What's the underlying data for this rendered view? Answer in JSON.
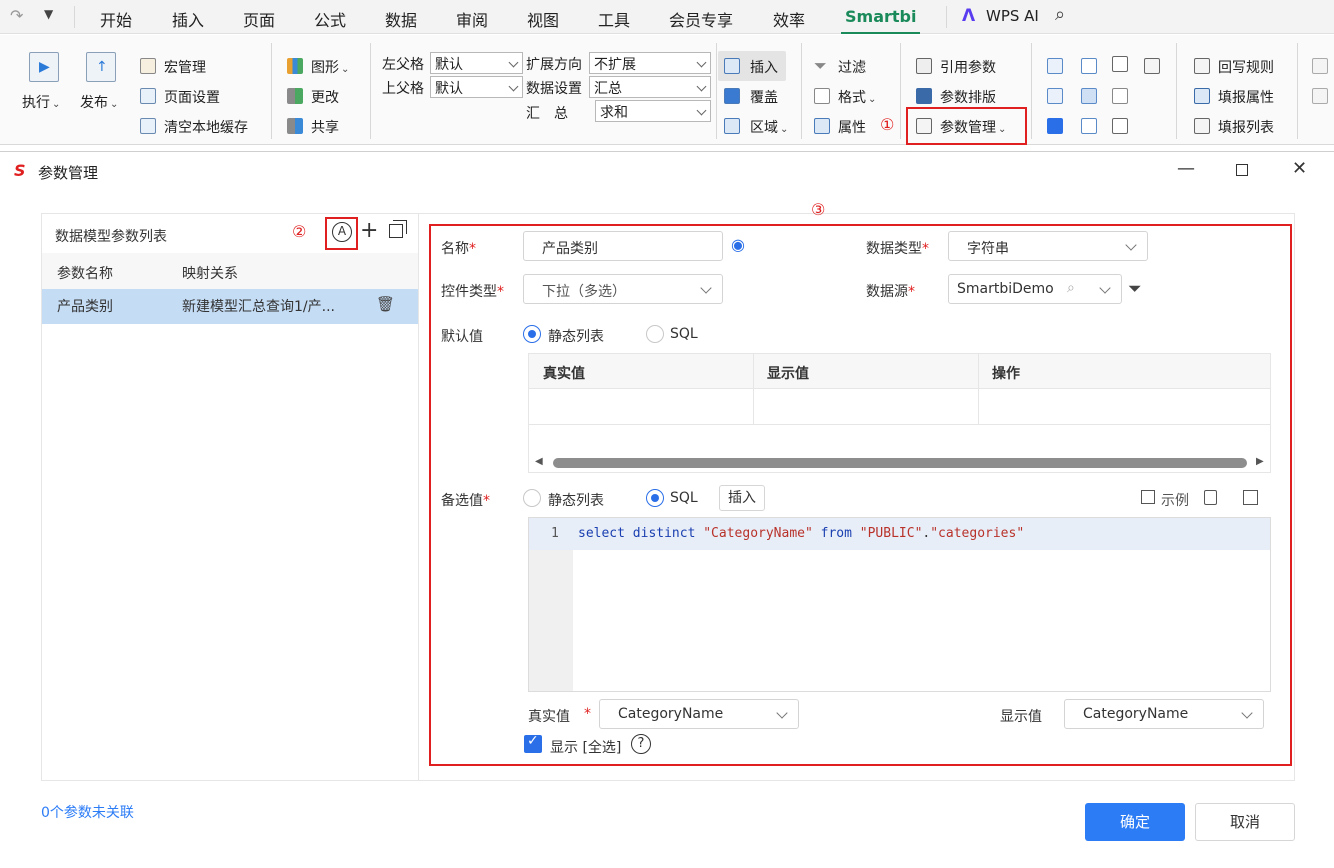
{
  "menubar": {
    "tabs": [
      "开始",
      "插入",
      "页面",
      "公式",
      "数据",
      "审阅",
      "视图",
      "工具",
      "会员专享",
      "效率",
      "Smartbi"
    ],
    "active_tab": "Smartbi",
    "wps_ai": "WPS AI"
  },
  "ribbon": {
    "exec": "执行",
    "publish": "发布",
    "macro": "宏管理",
    "page_setup": "页面设置",
    "clear_cache": "清空本地缓存",
    "graph": "图形",
    "change": "更改",
    "share": "共享",
    "left_parent_label": "左父格",
    "left_parent_value": "默认",
    "top_parent_label": "上父格",
    "top_parent_value": "默认",
    "expand_dir_label": "扩展方向",
    "expand_dir_value": "不扩展",
    "data_setting_label": "数据设置",
    "data_setting_value": "汇总",
    "summary_label": "汇　总",
    "summary_value": "求和",
    "insert": "插入",
    "cover": "覆盖",
    "region": "区域",
    "filter": "过滤",
    "format": "格式",
    "property": "属性",
    "ref_param": "引用参数",
    "param_layout": "参数排版",
    "param_manage": "参数管理",
    "writeback_rule": "回写规则",
    "fill_property": "填报属性",
    "fill_list": "填报列表"
  },
  "markers": {
    "one": "①",
    "two": "②",
    "three": "③"
  },
  "dialog": {
    "title": "参数管理",
    "left_panel_title": "数据模型参数列表",
    "col_param_name": "参数名称",
    "col_mapping": "映射关系",
    "rows": [
      {
        "name": "产品类别",
        "mapping": "新建模型汇总查询1/产..."
      }
    ],
    "unlinked": "0个参数未关联",
    "ok": "确定",
    "cancel": "取消"
  },
  "form": {
    "name_label": "名称",
    "name_value": "产品类别",
    "datatype_label": "数据类型",
    "datatype_value": "字符串",
    "control_label": "控件类型",
    "control_value": "下拉（多选）",
    "datasource_label": "数据源",
    "datasource_value": "SmartbiDemo",
    "default_label": "默认值",
    "opt_static": "静态列表",
    "opt_sql": "SQL",
    "table_headers": [
      "真实值",
      "显示值",
      "操作"
    ],
    "candidate_label": "备选值",
    "insert_btn": "插入",
    "example": "示例",
    "line_no": "1",
    "sql_kw1": "select distinct ",
    "sql_col": "\"CategoryName\"",
    "sql_kw2": " from ",
    "sql_schema": "\"PUBLIC\"",
    "sql_dot": ".",
    "sql_table": "\"categories\"",
    "real_label": "真实值",
    "real_value": "CategoryName",
    "display_label": "显示值",
    "display_value": "CategoryName",
    "show_all": "显示 [全选]",
    "help": "?"
  },
  "colors": {
    "accent": "#2c7cf6",
    "smartbi_green": "#1b8a5a",
    "highlight_red": "#e02020",
    "selected_row": "#c5dcf5"
  }
}
